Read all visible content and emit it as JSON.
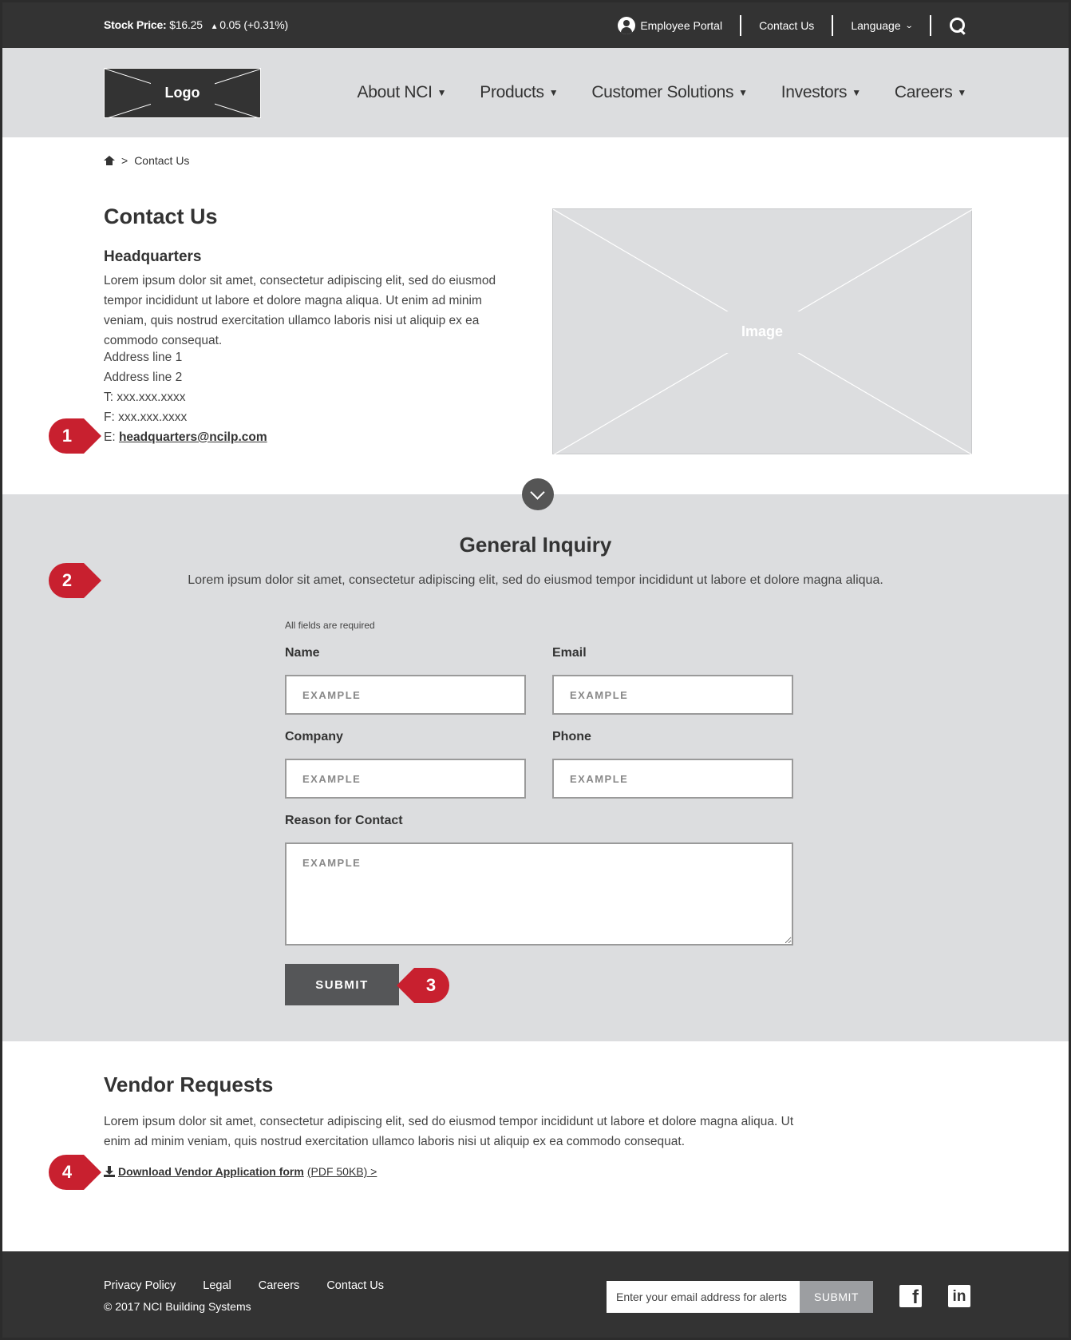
{
  "utility_bar": {
    "stock_label": "Stock Price:",
    "stock_price": "$16.25",
    "stock_change": "0.05 (+0.31%)",
    "employee_portal": "Employee Portal",
    "contact_us": "Contact Us",
    "language": "Language"
  },
  "nav": {
    "logo": "Logo",
    "items": [
      {
        "label": "About NCI"
      },
      {
        "label": "Products"
      },
      {
        "label": "Customer Solutions"
      },
      {
        "label": "Investors"
      },
      {
        "label": "Careers"
      }
    ]
  },
  "breadcrumb": {
    "separator": ">",
    "current": "Contact Us"
  },
  "contact": {
    "title": "Contact Us",
    "hq_title": "Headquarters",
    "hq_body": "Lorem ipsum dolor sit amet, consectetur adipiscing elit, sed do eiusmod tempor incididunt ut labore et dolore magna aliqua. Ut enim ad minim veniam, quis nostrud exercitation ullamco laboris nisi ut aliquip ex ea commodo consequat.",
    "address_line_1": "Address line 1",
    "address_line_2": "Address line 2",
    "phone": "T: xxx.xxx.xxxx",
    "fax": "F: xxx.xxx.xxxx",
    "email_prefix": "E:",
    "email": "headquarters@ncilp.com",
    "image_label": "Image"
  },
  "inquiry": {
    "title": "General Inquiry",
    "body": "Lorem ipsum dolor sit amet, consectetur adipiscing elit, sed do eiusmod tempor incididunt ut labore et dolore magna aliqua.",
    "required_note": "All fields are required",
    "name_label": "Name",
    "email_label": "Email",
    "company_label": "Company",
    "phone_label": "Phone",
    "reason_label": "Reason for Contact",
    "placeholder": "EXAMPLE",
    "submit_label": "SUBMIT"
  },
  "vendor": {
    "title": "Vendor Requests",
    "body": "Lorem ipsum dolor sit amet, consectetur adipiscing elit, sed do eiusmod tempor incididunt ut labore et dolore magna aliqua. Ut enim ad minim veniam, quis nostrud exercitation ullamco laboris nisi ut aliquip ex ea commodo consequat.",
    "download_label": "Download Vendor Application form",
    "download_meta": "(PDF 50KB) >"
  },
  "markers": {
    "m1": "1",
    "m2": "2",
    "m3": "3",
    "m4": "4"
  },
  "footer": {
    "links": [
      "Privacy Policy",
      "Legal",
      "Careers",
      "Contact Us"
    ],
    "copyright": "© 2017 NCI Building Systems",
    "alert_placeholder": "Enter your email address for alerts",
    "alert_submit": "SUBMIT",
    "facebook": "f",
    "linkedin": "in"
  },
  "colors": {
    "dark_bar": "#333333",
    "light_gray": "#dcdddf",
    "button_gray": "#555658",
    "marker_red": "#c8202f"
  },
  "icons": [
    "user-icon",
    "chevron-down-icon",
    "search-icon",
    "home-icon",
    "arrow-down-circle-icon",
    "download-icon",
    "facebook-icon",
    "linkedin-icon"
  ]
}
